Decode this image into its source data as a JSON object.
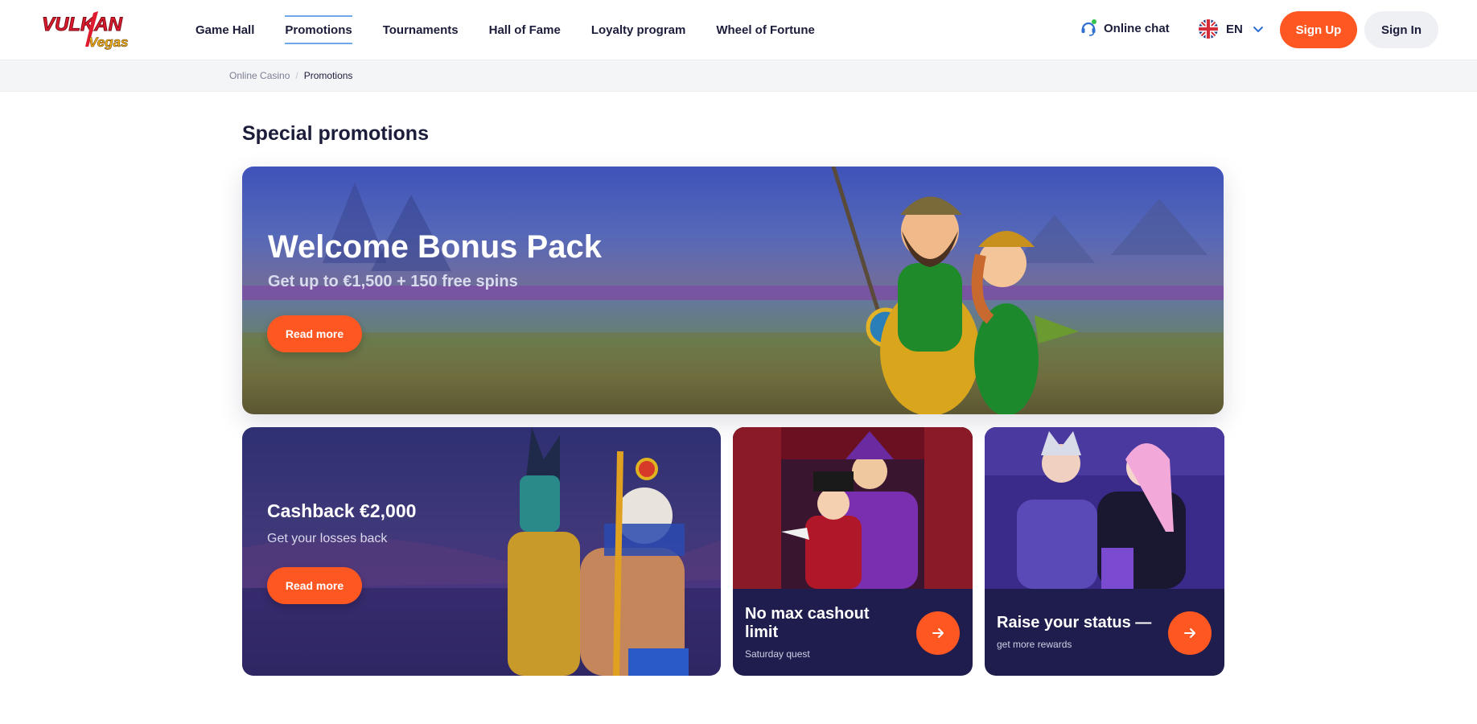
{
  "header": {
    "nav": [
      {
        "label": "Game Hall"
      },
      {
        "label": "Promotions"
      },
      {
        "label": "Tournaments"
      },
      {
        "label": "Hall of Fame"
      },
      {
        "label": "Loyalty program"
      },
      {
        "label": "Wheel of Fortune"
      }
    ],
    "active_nav": "Promotions",
    "chat_label": "Online chat",
    "language": "EN",
    "signup_label": "Sign Up",
    "signin_label": "Sign In"
  },
  "breadcrumb": {
    "home": "Online Casino",
    "current": "Promotions"
  },
  "page": {
    "title": "Special promotions"
  },
  "promos": {
    "welcome": {
      "title": "Welcome Bonus Pack",
      "subtitle": "Get up to €1,500 + 150 free spins",
      "button": "Read more"
    },
    "cashback": {
      "title": "Cashback €2,000",
      "subtitle": "Get your losses back",
      "button": "Read more"
    },
    "cashout": {
      "title_line1": "No max cashout",
      "title_line2": "limit",
      "subtitle": "Saturday quest"
    },
    "status": {
      "title": "Raise your status —",
      "subtitle": "get more rewards"
    }
  },
  "colors": {
    "accent": "#ff5722",
    "nav_active": "#6fa8e8",
    "card_dark": "#1e1d4d"
  }
}
